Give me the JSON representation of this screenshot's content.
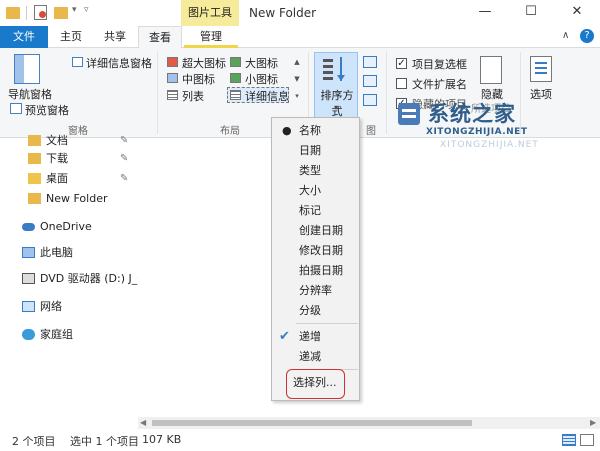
{
  "window": {
    "title": "New Folder",
    "contextual_tab": "图片工具",
    "min_glyph": "—",
    "max_glyph": "☐",
    "close_glyph": "✕"
  },
  "tabs": {
    "file": "文件",
    "home": "主页",
    "share": "共享",
    "view": "查看",
    "manage": "管理",
    "collapse_glyph": "∧",
    "help_glyph": "?"
  },
  "ribbon": {
    "panes": {
      "nav_pane": "导航窗格",
      "preview_pane": "预览窗格",
      "details_pane": "详细信息窗格",
      "group_label": "窗格"
    },
    "layout": {
      "extra_large": "超大图标",
      "large": "大图标",
      "medium": "中图标",
      "small": "小图标",
      "list": "列表",
      "details": "详细信息",
      "group_label": "布局"
    },
    "current_view": {
      "sort_by": "排序方式",
      "group_label_tail": "图"
    },
    "show_hide": {
      "item_checkboxes": "项目复选框",
      "file_extensions": "文件扩展名",
      "hidden_items": "隐藏的项目",
      "hide_selected": "隐藏",
      "hide_selected_line2": "所选项目",
      "options": "选项"
    }
  },
  "nav": {
    "items": [
      {
        "label": "文档"
      },
      {
        "label": "下载"
      },
      {
        "label": "桌面"
      },
      {
        "label": "New Folder"
      },
      {
        "label": "OneDrive"
      },
      {
        "label": "此电脑"
      },
      {
        "label": "DVD 驱动器 (D:) J_C"
      },
      {
        "label": "网络"
      },
      {
        "label": "家庭组"
      }
    ]
  },
  "sort_menu": {
    "items": [
      {
        "label": "名称",
        "selected": true
      },
      {
        "label": "日期"
      },
      {
        "label": "类型"
      },
      {
        "label": "大小"
      },
      {
        "label": "标记"
      },
      {
        "label": "创建日期"
      },
      {
        "label": "修改日期"
      },
      {
        "label": "拍摄日期"
      },
      {
        "label": "分辨率"
      },
      {
        "label": "分级"
      }
    ],
    "ascending": "递增",
    "descending": "递减",
    "choose_columns": "选择列..."
  },
  "status": {
    "item_count": "2 个项目",
    "selected": "选中 1 个项目",
    "size": "107 KB"
  },
  "watermark": {
    "title": "系统之家",
    "url": "XITONGZHIJIA.NET",
    "url_faded": "XITONGZHIJIA.NET"
  },
  "colors": {
    "file_tab": "#1979ca",
    "contextual_tab": "#f5eb9a",
    "menu_highlight_border": "#d03030",
    "watermark": "#2f5e8c"
  }
}
